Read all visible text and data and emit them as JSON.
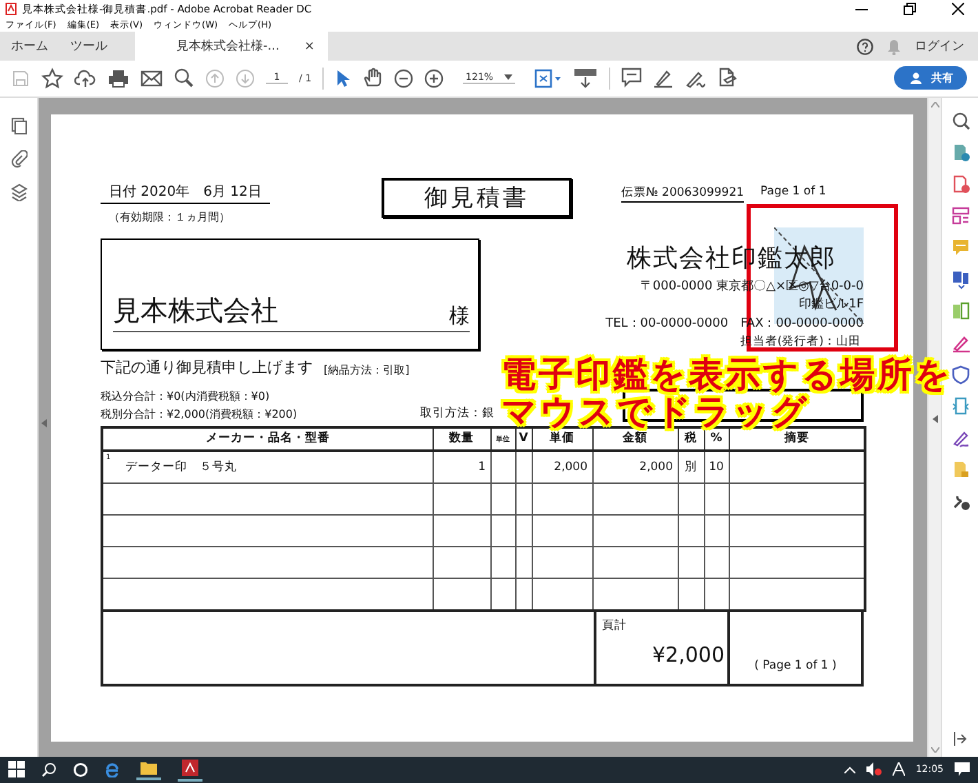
{
  "window": {
    "title": "見本株式会社様-御見積書.pdf - Adobe Acrobat Reader DC"
  },
  "menu": [
    "ファイル(F)",
    "編集(E)",
    "表示(V)",
    "ウィンドウ(W)",
    "ヘルプ(H)"
  ],
  "tabs": [
    {
      "label": "ホーム",
      "selected": false
    },
    {
      "label": "ツール",
      "selected": false
    },
    {
      "label": "見本株式会社様-...",
      "selected": true,
      "close": "×"
    }
  ],
  "account": {
    "login": "ログイン"
  },
  "toolbar": {
    "page_current": "1",
    "page_total": "/ 1",
    "zoom": "121%",
    "share": "共有"
  },
  "document": {
    "date": "日付 2020年　6月 12日",
    "validity": "（有効期限：１ヵ月間）",
    "title": "御見積書",
    "slip": "伝票№ 20063099921",
    "page": "Page 1 of 1",
    "customer": "見本株式会社",
    "honorific": "様",
    "issuer": {
      "name": "株式会社印鑑太郎",
      "address": "〒000-0000 東京都〇△×区◎▽台0-0-0",
      "building": "印鑑ビル1F",
      "contact": "TEL：00-0000-0000　FAX：00-0000-0000",
      "person": "担当者(発行者)：山田"
    },
    "intro": "下記の通り御見積申し上げます",
    "delivery": "[納品方法：引取]",
    "tax_included": "税込分合計：¥0(内消費税額：¥0)",
    "tax_excluded": "税別分合計：¥2,000(消費税額：¥200)",
    "payment": "取引方法：銀",
    "table": {
      "columns": [
        "メーカー・品名・型番",
        "数量",
        "単位",
        "V",
        "単価",
        "金額",
        "税",
        "%",
        "摘要"
      ],
      "rows": [
        {
          "line_no": "1",
          "item": "データー印　５号丸",
          "qty": "1",
          "unit_price": "2,000",
          "amount": "2,000",
          "tax": "別",
          "rate": "10"
        }
      ]
    },
    "page_total": {
      "label": "頁計",
      "amount": "¥2,000"
    },
    "footer_page": "( Page 1 of 1 )"
  },
  "overlay": {
    "caption": [
      "電子印鑑を表示する場所を",
      "マウスでドラッグ"
    ]
  },
  "taskbar": {
    "time": "12:05"
  }
}
